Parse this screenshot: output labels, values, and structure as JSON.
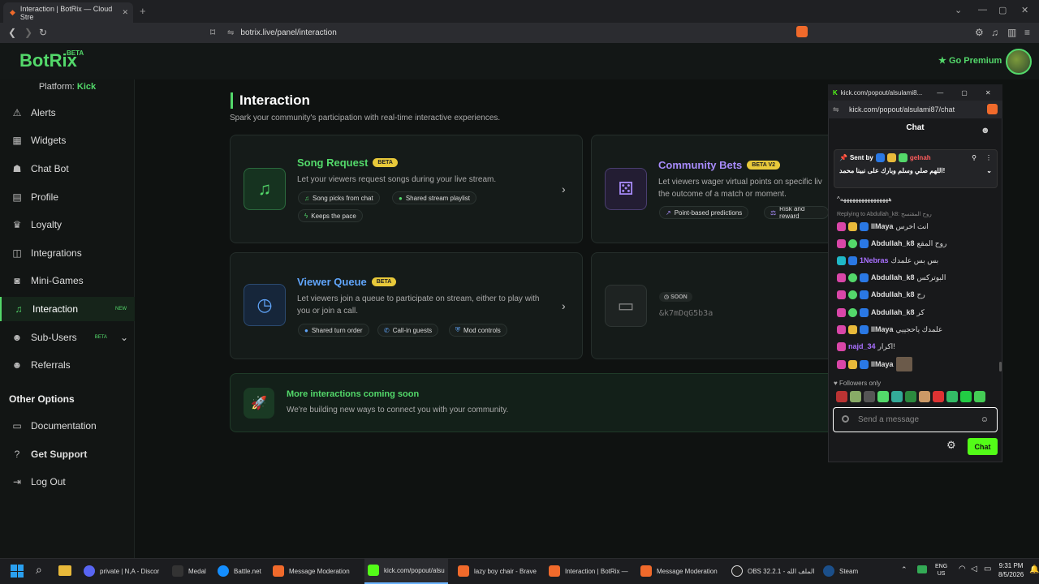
{
  "browser": {
    "tab_title": "Interaction | BotRix — Cloud Stre",
    "url": "botrix.live/panel/interaction"
  },
  "app": {
    "logo": "BotRix",
    "logo_badge": "BETA",
    "go_premium": "Go Premium",
    "platform_label": "Platform:",
    "platform_value": "Kick"
  },
  "sidebar": {
    "items": [
      {
        "label": "Alerts",
        "icon": "alert-icon"
      },
      {
        "label": "Widgets",
        "icon": "widgets-icon"
      },
      {
        "label": "Chat Bot",
        "icon": "bot-icon"
      },
      {
        "label": "Profile",
        "icon": "profile-icon"
      },
      {
        "label": "Loyalty",
        "icon": "trophy-icon"
      },
      {
        "label": "Integrations",
        "icon": "integrations-icon"
      },
      {
        "label": "Mini-Games",
        "icon": "gamepad-icon"
      },
      {
        "label": "Interaction",
        "icon": "music-icon",
        "tag": "NEW"
      },
      {
        "label": "Sub-Users",
        "icon": "users-icon",
        "tag": "BETA"
      },
      {
        "label": "Referrals",
        "icon": "referrals-icon"
      }
    ],
    "other_header": "Other Options",
    "other_items": [
      {
        "label": "Documentation",
        "icon": "doc-icon"
      },
      {
        "label": "Get Support",
        "icon": "help-icon"
      },
      {
        "label": "Log Out",
        "icon": "logout-icon"
      }
    ]
  },
  "page": {
    "title": "Interaction",
    "subtitle": "Spark your community's participation with real-time interactive experiences."
  },
  "cards": {
    "song": {
      "title": "Song Request",
      "badge": "BETA",
      "desc": "Let your viewers request songs during your live stream.",
      "chips": [
        "Song picks from chat",
        "Shared stream playlist",
        "Keeps the pace"
      ]
    },
    "bets": {
      "title": "Community Bets",
      "badge": "BETA V2",
      "desc1": "Let viewers wager virtual points on specific liv",
      "desc2": "the outcome of a match or moment.",
      "chips": [
        "Point-based predictions",
        "Risk and reward"
      ]
    },
    "queue": {
      "title": "Viewer Queue",
      "badge": "BETA",
      "desc1": "Let viewers join a queue to participate on stream, either to play with",
      "desc2": "you or join a call.",
      "chips": [
        "Shared turn order",
        "Call-in guests",
        "Mod controls"
      ]
    },
    "soon": {
      "badge": "SOON",
      "code": "&k7mDqG5b3a"
    },
    "more": {
      "title": "More interactions coming soon",
      "desc": "We're building new ways to connect you with your community."
    }
  },
  "chat": {
    "window_title": "kick.com/popout/alsulami8...",
    "url": "kick.com/popout/alsulami87/chat",
    "header": "Chat",
    "pinned_sent_by": "Sent by",
    "pinned_user": "gelnah",
    "pinned_text": "اللهم صلي وسلم وبارك على نبينا محمد!",
    "flood": "^ههههههههههههههههه",
    "reply_note": "Replying to Abdullah_k8: روح المقتسح",
    "messages": [
      {
        "user": "IIMaya",
        "text": "انت اخرس",
        "color": "#ffffff"
      },
      {
        "user": "Abdullah_k8",
        "text": "روح المقع",
        "color": "#ffffff"
      },
      {
        "user": "1Nebras",
        "text": "بس بس علمدك",
        "color": "#a970ff"
      },
      {
        "user": "Abdullah_k8",
        "text": "البوتركس",
        "color": "#ffffff"
      },
      {
        "user": "Abdullah_k8",
        "text": "رح",
        "color": "#ffffff"
      },
      {
        "user": "Abdullah_k8",
        "text": "كر",
        "color": "#ffffff"
      },
      {
        "user": "IIMaya",
        "text": "علمدك ياحجييي",
        "color": "#ffffff"
      },
      {
        "user": "najd_34",
        "text": "اكرار!",
        "color": "#a970ff"
      },
      {
        "user": "IIMaya",
        "text": "",
        "color": "#ffffff"
      }
    ],
    "followers_only": "Followers only",
    "placeholder": "Send a message",
    "send_label": "Chat"
  },
  "taskbar": {
    "items": [
      "private | N,A - Discor",
      "Medal",
      "Battle.net",
      "Message Moderation",
      "kick.com/popout/alsu",
      "lazy boy chair - Brave",
      "Interaction | BotRix —",
      "Message Moderation",
      "OBS 32.2.1 - الملف الله",
      "Steam"
    ],
    "lang1": "ENG",
    "lang2": "US",
    "time": "9:31 PM",
    "date": "8/5/2026"
  }
}
